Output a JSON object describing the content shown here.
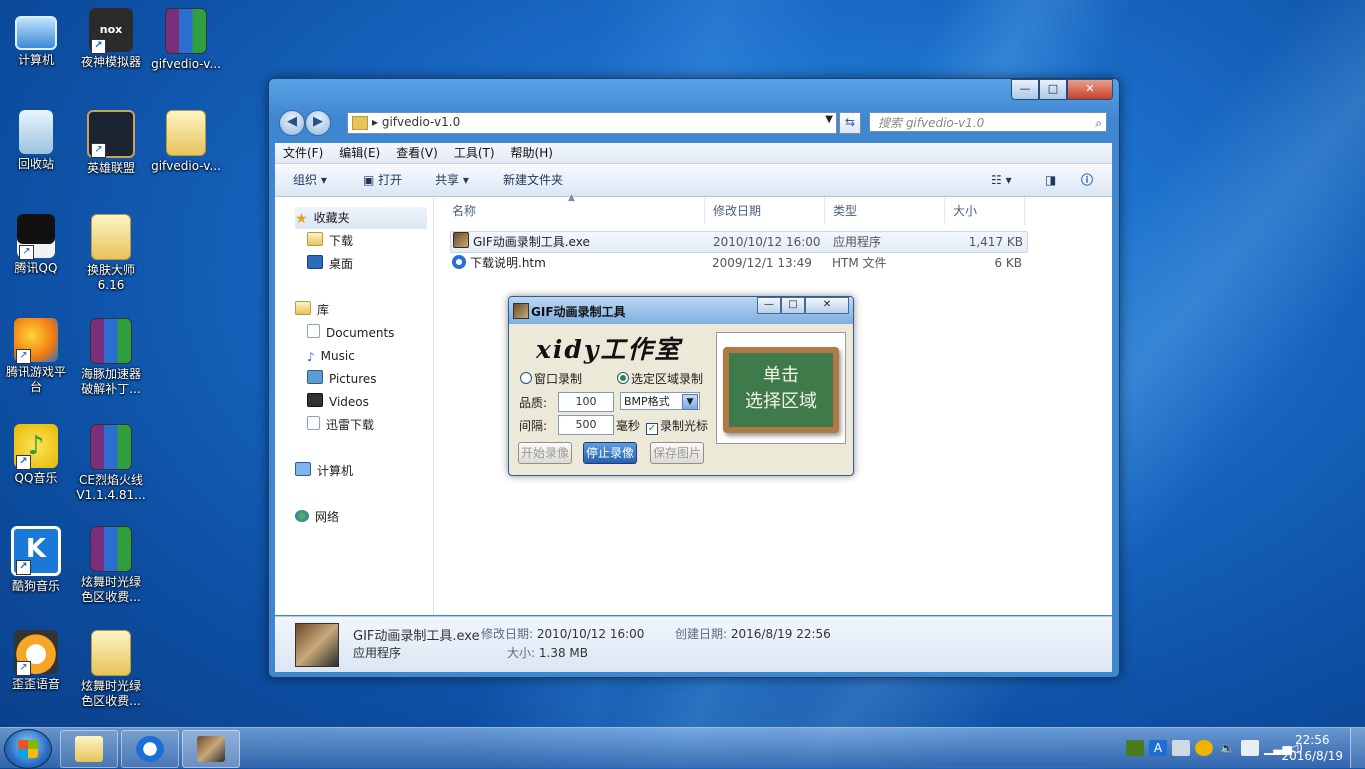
{
  "desktop": {
    "icons": [
      {
        "label": "计算机",
        "icon": "computer-icon"
      },
      {
        "label": "夜神模拟器",
        "icon": "nox-icon",
        "text": "nox"
      },
      {
        "label": "gifvedio-v...",
        "icon": "rar-archive-icon"
      },
      {
        "label": "回收站",
        "icon": "recycle-bin-icon"
      },
      {
        "label": "英雄联盟",
        "icon": "lol-icon"
      },
      {
        "label": "gifvedio-v...",
        "icon": "folder-icon"
      },
      {
        "label": "腾讯QQ",
        "icon": "qq-icon"
      },
      {
        "label": "换肤大师",
        "label2": "6.16",
        "icon": "folder-icon"
      },
      {
        "label": "腾讯游戏平",
        "label2": "台",
        "icon": "tencent-game-icon"
      },
      {
        "label": "海豚加速器",
        "label2": "破解补丁...",
        "icon": "rar-archive-icon"
      },
      {
        "label": "QQ音乐",
        "icon": "qqmusic-icon"
      },
      {
        "label": "CE烈焰火线",
        "label2": "V1.1.4.81...",
        "icon": "rar-archive-icon"
      },
      {
        "label": "酷狗音乐",
        "icon": "kugou-icon",
        "text": "K"
      },
      {
        "label": "炫舞时光绿",
        "label2": "色区收费...",
        "icon": "rar-archive-icon"
      },
      {
        "label": "歪歪语音",
        "icon": "yy-icon"
      },
      {
        "label": "炫舞时光绿",
        "label2": "色区收费...",
        "icon": "folder-icon"
      }
    ]
  },
  "explorer": {
    "address": "gifvedio-v1.0",
    "search_placeholder": "搜索 gifvedio-v1.0",
    "controls": {
      "min": "—",
      "max": "□",
      "close": "✕"
    },
    "menu": [
      "文件(F)",
      "编辑(E)",
      "查看(V)",
      "工具(T)",
      "帮助(H)"
    ],
    "toolbar": {
      "organize": "组织 ▾",
      "open": "打开",
      "share": "共享 ▾",
      "new_folder": "新建文件夹"
    },
    "nav": {
      "favorites": "收藏夹",
      "downloads": "下载",
      "desktop": "桌面",
      "libraries": "库",
      "documents": "Documents",
      "music": "Music",
      "pictures": "Pictures",
      "videos": "Videos",
      "xunlei": "迅雷下载",
      "computer": "计算机",
      "network": "网络"
    },
    "columns": {
      "name": "名称",
      "modified": "修改日期",
      "type": "类型",
      "size": "大小"
    },
    "files": [
      {
        "name": "GIF动画录制工具.exe",
        "modified": "2010/10/12 16:00",
        "type": "应用程序",
        "size": "1,417 KB",
        "selected": true
      },
      {
        "name": "下载说明.htm",
        "modified": "2009/12/1 13:49",
        "type": "HTM 文件",
        "size": "6 KB",
        "selected": false
      }
    ],
    "details": {
      "filename": "GIF动画录制工具.exe",
      "filetype": "应用程序",
      "modified_label": "修改日期:",
      "modified": "2010/10/12 16:00",
      "created_label": "创建日期:",
      "created": "2016/8/19 22:56",
      "size_label": "大小:",
      "size": "1.38 MB"
    }
  },
  "gif_tool": {
    "title": "GIF动画录制工具",
    "brand": "xidy工作室",
    "radio_window": "窗口录制",
    "radio_region": "选定区域录制",
    "quality_label": "品质:",
    "quality_value": "100",
    "format": "BMP格式",
    "interval_label": "间隔:",
    "interval_value": "500",
    "interval_unit": "毫秒",
    "record_cursor": "录制光标",
    "btn_start": "开始录像",
    "btn_stop": "停止录像",
    "btn_save": "保存图片",
    "board_line1": "单击",
    "board_line2": "选择区域"
  },
  "taskbar": {
    "clock_time": "22:56",
    "clock_date": "2016/8/19"
  }
}
